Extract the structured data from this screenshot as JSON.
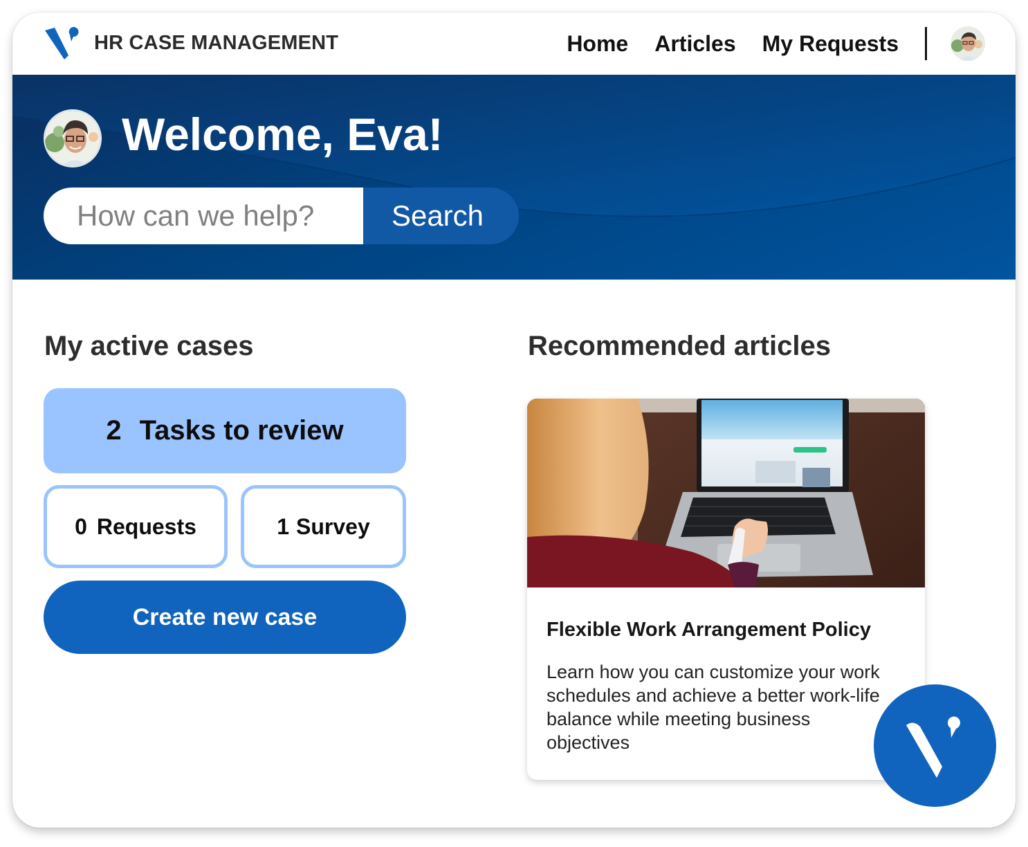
{
  "app": {
    "brand": "HR CASE MANAGEMENT",
    "logo_icon": "brand-v-logo-icon",
    "brand_color": "#1064bd"
  },
  "nav": {
    "items": [
      {
        "label": "Home"
      },
      {
        "label": "Articles"
      },
      {
        "label": "My Requests"
      }
    ],
    "avatar_icon": "user-avatar"
  },
  "hero": {
    "welcome": "Welcome, Eva!",
    "search": {
      "placeholder": "How can we help?",
      "value": "",
      "button_label": "Search"
    }
  },
  "cases": {
    "heading": "My active cases",
    "tasks": {
      "count": "2",
      "label": "Tasks to review"
    },
    "requests": {
      "count": "0",
      "label": "Requests"
    },
    "survey": {
      "count": "1",
      "label": "Survey"
    },
    "create_label": "Create new case",
    "colors": {
      "tasks_bg": "#9ac4ff",
      "button_bg": "#1064bd"
    }
  },
  "articles": {
    "heading": "Recommended articles",
    "items": [
      {
        "image": "person-using-laptop-photo",
        "title": "Flexible Work Arrangement Policy",
        "description": "Learn how you can customize your work schedules and achieve a better work-life balance while meeting business objectives"
      }
    ]
  }
}
